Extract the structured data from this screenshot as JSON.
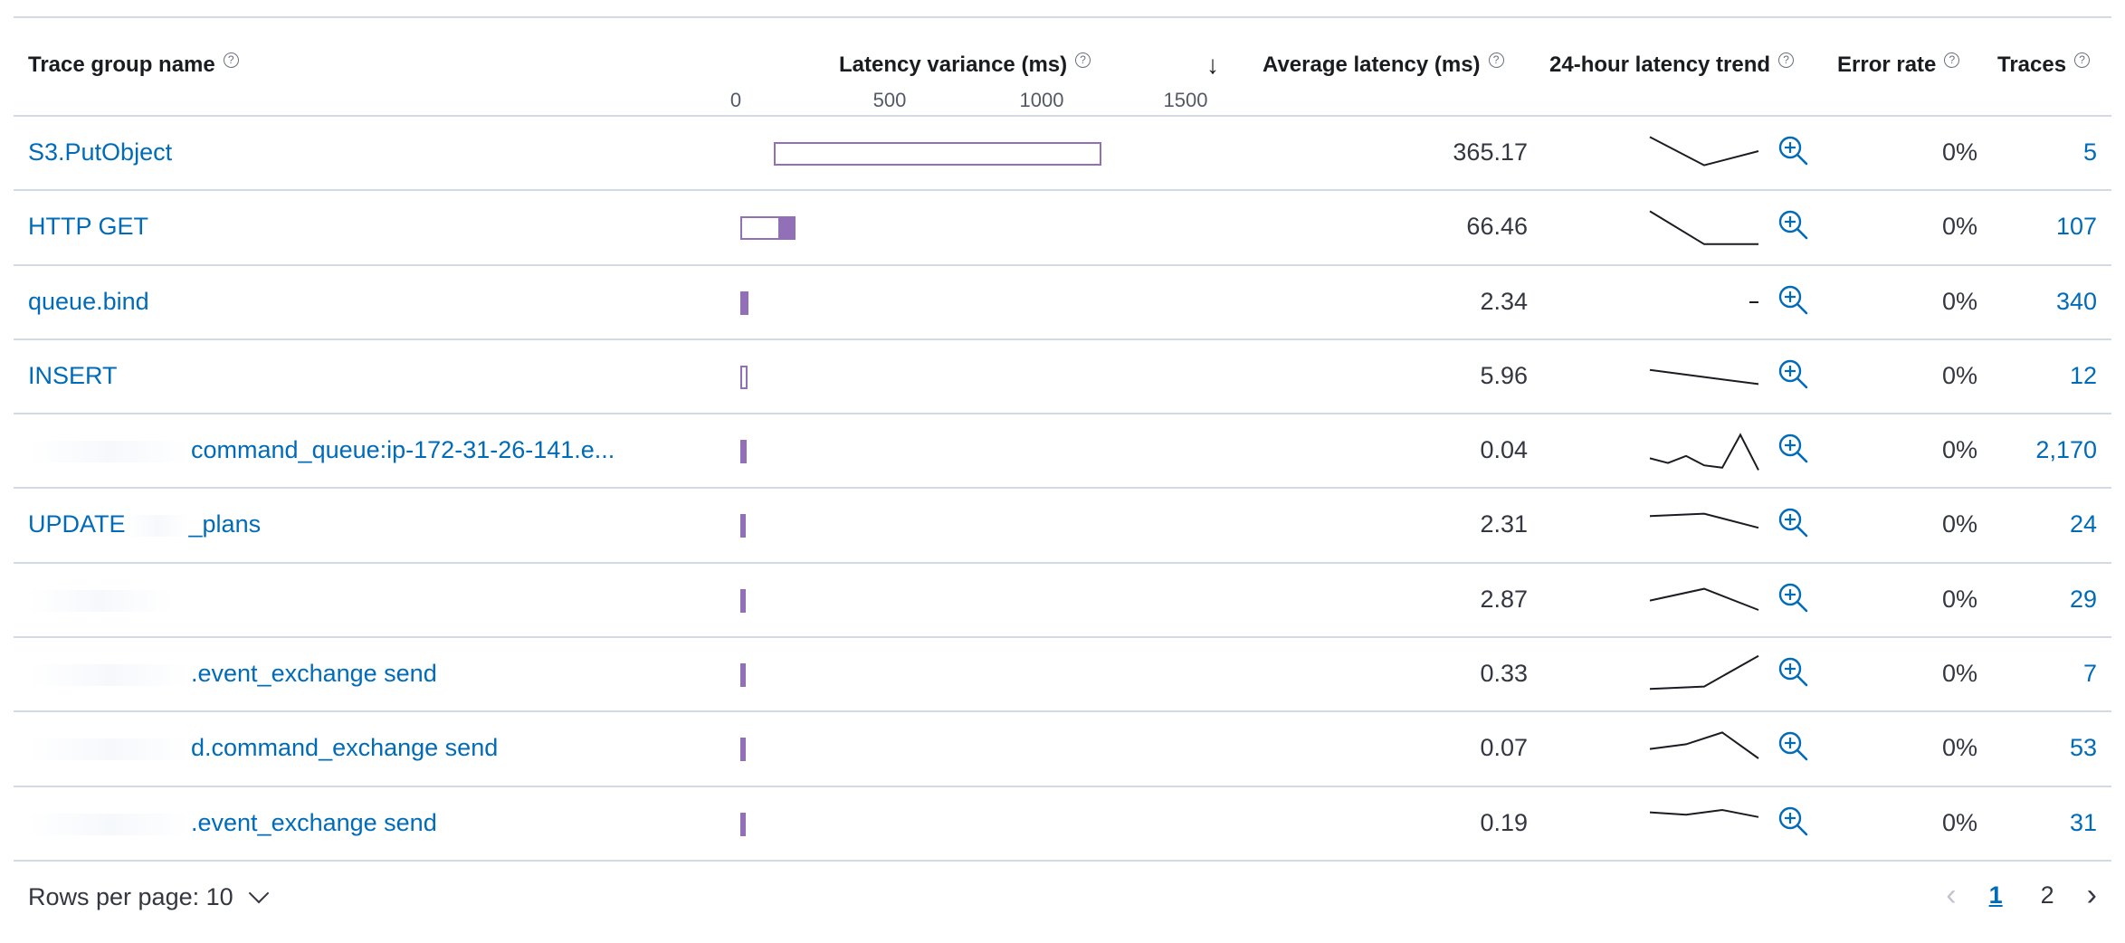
{
  "header": {
    "trace_group_name": "Trace group name",
    "latency_variance": "Latency variance (ms)",
    "average_latency": "Average latency (ms)",
    "latency_trend": "24-hour latency trend",
    "error_rate": "Error rate",
    "traces": "Traces",
    "info_glyph": "?",
    "sort_glyph": "↓",
    "ticks": [
      "0",
      "500",
      "1000",
      "1500"
    ]
  },
  "rows": [
    {
      "name": "S3.PutObject",
      "redacted": "",
      "suffix": "",
      "variance_min": 110,
      "variance_max": 1180,
      "avg": "365.17",
      "error": "0%",
      "traces": "5",
      "trend": [
        0.2,
        0.8,
        0.5
      ]
    },
    {
      "name": "HTTP GET",
      "redacted": "",
      "suffix": "",
      "variance_min": 0,
      "variance_max": 180,
      "variance_fill_from": 125,
      "avg": "66.46",
      "error": "0%",
      "traces": "107",
      "trend": [
        0.2,
        0.9,
        0.9
      ]
    },
    {
      "name": "queue.bind",
      "redacted": "",
      "suffix": "",
      "variance_min": 0,
      "variance_max": 28,
      "variance_fill_from": 0,
      "avg": "2.34",
      "error": "0%",
      "traces": "340",
      "trend": []
    },
    {
      "name": "INSERT",
      "redacted": "",
      "suffix": "",
      "variance_min": 0,
      "variance_max": 25,
      "avg": "5.96",
      "error": "0%",
      "traces": "12",
      "trend": [
        0.4,
        0.55,
        0.7
      ]
    },
    {
      "name": "",
      "redacted": "",
      "suffix": "command_queue:ip-172-31-26-141.e...",
      "variance_min": 0,
      "variance_max": 20,
      "variance_fill_from": 0,
      "avg": "0.04",
      "error": "0%",
      "traces": "2,170",
      "trend": [
        0.7,
        0.8,
        0.65,
        0.85,
        0.9,
        0.2,
        0.95
      ]
    },
    {
      "name": "UPDATE",
      "redacted": "",
      "suffix": "_plans",
      "variance_min": 0,
      "variance_max": 15,
      "variance_fill_from": 0,
      "avg": "2.31",
      "error": "0%",
      "traces": "24",
      "trend": [
        0.35,
        0.3,
        0.6
      ]
    },
    {
      "name": "",
      "redacted": "",
      "suffix": "",
      "variance_min": 0,
      "variance_max": 12,
      "variance_fill_from": 0,
      "avg": "2.87",
      "error": "0%",
      "traces": "29",
      "trend": [
        0.55,
        0.3,
        0.75
      ]
    },
    {
      "name": "",
      "redacted": "",
      "suffix": ".event_exchange send",
      "variance_min": 0,
      "variance_max": 6,
      "variance_fill_from": 0,
      "avg": "0.33",
      "error": "0%",
      "traces": "7",
      "trend": [
        0.85,
        0.8,
        0.15
      ]
    },
    {
      "name": "",
      "redacted": "",
      "suffix": "d.command_exchange send",
      "variance_min": 0,
      "variance_max": 4,
      "variance_fill_from": 0,
      "avg": "0.07",
      "error": "0%",
      "traces": "53",
      "trend": [
        0.55,
        0.45,
        0.2,
        0.75
      ]
    },
    {
      "name": "",
      "redacted": "",
      "suffix": ".event_exchange send",
      "variance_min": 0,
      "variance_max": 4,
      "variance_fill_from": 0,
      "avg": "0.19",
      "error": "0%",
      "traces": "31",
      "trend": [
        0.3,
        0.35,
        0.25,
        0.4
      ]
    }
  ],
  "footer": {
    "rows_per_page": "Rows per page: 10",
    "pages": [
      "1",
      "2"
    ],
    "active_page": "1",
    "prev_glyph": "‹",
    "next_glyph": "›"
  },
  "colors": {
    "link": "#006bb8",
    "bar": "#9170b8",
    "border": "#d3dae6"
  }
}
